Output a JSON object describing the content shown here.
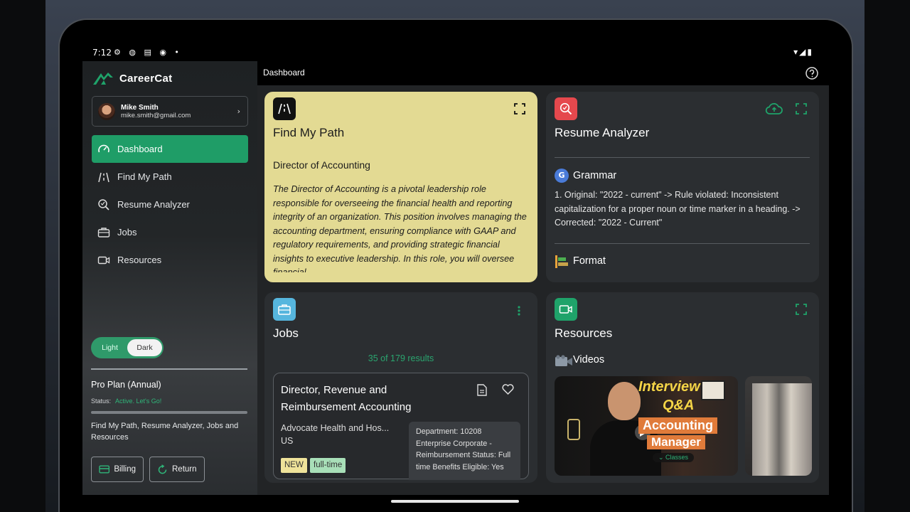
{
  "status_bar": {
    "time": "7:12",
    "icons": "⚙ ◍ ▤ ◉ •",
    "right_icons": "▾◢▮"
  },
  "sidebar": {
    "brand": "CareerCat",
    "user": {
      "name": "Mike Smith",
      "email": "mike.smith@gmail.com"
    },
    "items": [
      {
        "label": "Dashboard",
        "icon": "speedometer-icon",
        "active": true
      },
      {
        "label": "Find My Path",
        "icon": "path-icon"
      },
      {
        "label": "Resume Analyzer",
        "icon": "magnifier-icon"
      },
      {
        "label": "Jobs",
        "icon": "briefcase-icon"
      },
      {
        "label": "Resources",
        "icon": "video-icon"
      }
    ],
    "theme": {
      "light": "Light",
      "dark": "Dark",
      "selected": "Dark"
    },
    "plan": {
      "name": "Pro Plan (Annual)",
      "status_label": "Status:",
      "status_value": "Active. Let's Go!",
      "description": "Find My Path, Resume Analyzer, Jobs and Resources"
    },
    "billing_label": "Billing",
    "return_label": "Return"
  },
  "topbar": {
    "title": "Dashboard"
  },
  "find_my_path": {
    "title": "Find My Path",
    "role": "Director of Accounting",
    "description": "The Director of Accounting is a pivotal leadership role responsible for overseeing the financial health and reporting integrity of an organization. This position involves managing the accounting department, ensuring compliance with GAAP and regulatory requirements, and providing strategic financial insights to executive leadership. In this role, you will oversee financial"
  },
  "resume_analyzer": {
    "title": "Resume Analyzer",
    "grammar_label": "Grammar",
    "grammar_icon_letter": "G",
    "grammar_text": "1. Original: \"2022 - current\" -> Rule violated: Inconsistent capitalization for a proper noun or time marker in a heading. -> Corrected: \"2022 - Current\"",
    "format_label": "Format"
  },
  "jobs": {
    "title": "Jobs",
    "results": "35 of 179 results",
    "job": {
      "title": "Director, Revenue and Reimbursement Accounting",
      "company": "Advocate Health and Hos...",
      "location": "US",
      "tags": [
        "NEW",
        "full-time"
      ],
      "details": "Department: 10208 Enterprise Corporate - Reimbursement Status: Full time Benefits Eligible: Yes"
    }
  },
  "resources": {
    "title": "Resources",
    "videos_label": "Videos",
    "video": {
      "line1": "Interview",
      "line2": "Q&A",
      "line3": "Accounting",
      "line4": "Manager",
      "chip": "Classes"
    }
  },
  "colors": {
    "accent": "#1f9d67",
    "yellow_card": "#e3da93",
    "red_icon": "#e5484d",
    "teal_icon": "#56b6de",
    "green_icon": "#1fa36a"
  }
}
